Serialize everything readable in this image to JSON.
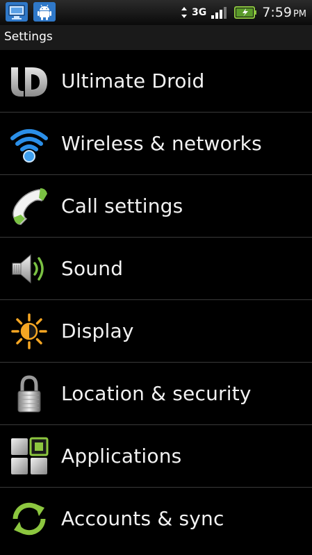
{
  "status_bar": {
    "network_type": "3G",
    "time": "7:59",
    "ampm": "PM",
    "icons": [
      "usb-debug-icon",
      "android-notification-icon",
      "data-arrows-icon",
      "signal-strength-icon",
      "battery-charging-icon"
    ]
  },
  "title": "Settings",
  "menu": {
    "items": [
      {
        "label": "Ultimate Droid",
        "icon": "ultimate-droid-logo-icon"
      },
      {
        "label": "Wireless & networks",
        "icon": "wifi-icon"
      },
      {
        "label": "Call settings",
        "icon": "phone-handset-icon"
      },
      {
        "label": "Sound",
        "icon": "speaker-icon"
      },
      {
        "label": "Display",
        "icon": "brightness-icon"
      },
      {
        "label": "Location & security",
        "icon": "padlock-icon"
      },
      {
        "label": "Applications",
        "icon": "apps-grid-icon"
      },
      {
        "label": "Accounts & sync",
        "icon": "sync-arrows-icon"
      }
    ]
  },
  "colors": {
    "background": "#000000",
    "divider": "#3a3a3a",
    "text": "#f2f2f2",
    "wifi_blue": "#1e90ff",
    "phone_green": "#7ac143",
    "sync_green": "#8cc63f",
    "display_orange": "#f5a623"
  }
}
